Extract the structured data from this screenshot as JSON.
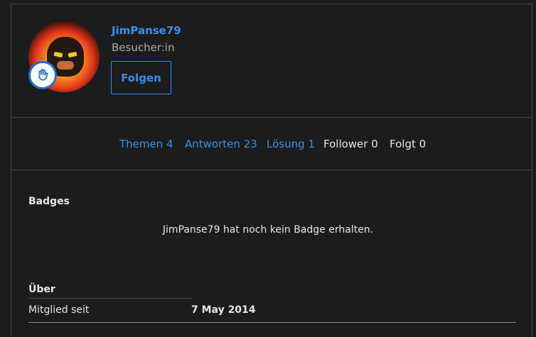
{
  "profile": {
    "username": "JimPanse79",
    "role": "Besucher:in",
    "follow_label": "Folgen"
  },
  "stats": [
    {
      "label": "Themen 4"
    },
    {
      "label": "Antworten 23"
    },
    {
      "label": "Lösung 1"
    },
    {
      "label": "Follower 0"
    },
    {
      "label": "Folgt 0"
    }
  ],
  "badges": {
    "title": "Badges",
    "empty_message": "JimPanse79 hat noch kein Badge erhalten."
  },
  "about": {
    "title": "Über",
    "member_since_label": "Mitglied seit",
    "member_since_value": "7 May 2014"
  },
  "colors": {
    "accent": "#3b8fe6",
    "background": "#1b1c1e",
    "border": "#45474b"
  },
  "icons": {
    "avatar_badge": "waving-hand-icon"
  }
}
